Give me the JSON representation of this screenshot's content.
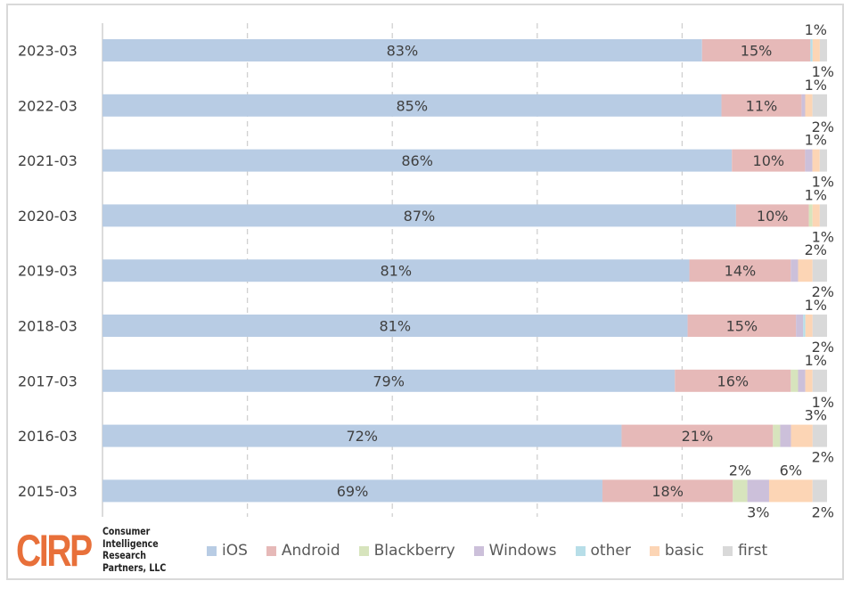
{
  "chart_data": {
    "type": "bar",
    "orientation": "horizontal",
    "stacked": "100%",
    "title": "",
    "xlabel": "",
    "ylabel": "",
    "xlim": [
      0,
      100
    ],
    "grid": true,
    "gridlines_at": [
      20,
      40,
      60,
      80
    ],
    "legend_position": "bottom",
    "categories": [
      "2023-03",
      "2022-03",
      "2021-03",
      "2020-03",
      "2019-03",
      "2018-03",
      "2017-03",
      "2016-03",
      "2015-03"
    ],
    "series": [
      {
        "name": "iOS",
        "color": "#b8cce4",
        "values": [
          83,
          85,
          86,
          87,
          81,
          81,
          79,
          72,
          69
        ]
      },
      {
        "name": "Android",
        "color": "#e6b9b8",
        "values": [
          15,
          11,
          10,
          10,
          14,
          15,
          16,
          21,
          18
        ]
      },
      {
        "name": "Blackberry",
        "color": "#d7e4bd",
        "values": [
          0,
          0,
          0,
          0.5,
          0,
          0,
          1,
          1,
          2
        ]
      },
      {
        "name": "Windows",
        "color": "#ccc0da",
        "values": [
          0,
          0.5,
          1,
          0,
          1,
          1,
          1,
          1.5,
          3
        ]
      },
      {
        "name": "other",
        "color": "#b7dee8",
        "values": [
          0.3,
          0,
          0,
          0,
          0,
          0.3,
          0,
          0,
          0
        ]
      },
      {
        "name": "basic",
        "color": "#fcd5b5",
        "values": [
          1,
          1,
          1,
          1,
          2,
          1,
          1,
          3,
          6
        ]
      },
      {
        "name": "first",
        "color": "#d9d9d9",
        "values": [
          1,
          2,
          1,
          1,
          2,
          2,
          2,
          2,
          2
        ]
      }
    ],
    "data_labels": [
      {
        "category": "2023-03",
        "inside": {
          "iOS": "83%",
          "Android": "15%"
        },
        "above": "1%",
        "below": "1%"
      },
      {
        "category": "2022-03",
        "inside": {
          "iOS": "85%",
          "Android": "11%"
        },
        "above": "1%",
        "below": "2%"
      },
      {
        "category": "2021-03",
        "inside": {
          "iOS": "86%",
          "Android": "10%"
        },
        "above": "1%",
        "below": "1%"
      },
      {
        "category": "2020-03",
        "inside": {
          "iOS": "87%",
          "Android": "10%"
        },
        "above": "1%",
        "below": "1%"
      },
      {
        "category": "2019-03",
        "inside": {
          "iOS": "81%",
          "Android": "14%"
        },
        "above": "2%",
        "below": "2%"
      },
      {
        "category": "2018-03",
        "inside": {
          "iOS": "81%",
          "Android": "15%"
        },
        "above": "1%",
        "below": "2%"
      },
      {
        "category": "2017-03",
        "inside": {
          "iOS": "79%",
          "Android": "16%"
        },
        "above": "1%",
        "below": "1%"
      },
      {
        "category": "2016-03",
        "inside": {
          "iOS": "72%",
          "Android": "21%"
        },
        "above": "3%",
        "below": "2%"
      },
      {
        "category": "2015-03",
        "inside": {
          "iOS": "69%",
          "Android": "18%"
        },
        "above_blackberry": "2%",
        "above_basic": "6%",
        "below_windows": "3%",
        "below_first": "2%"
      }
    ]
  },
  "legend": [
    {
      "name": "iOS",
      "color": "#b8cce4"
    },
    {
      "name": "Android",
      "color": "#e6b9b8"
    },
    {
      "name": "Blackberry",
      "color": "#d7e4bd"
    },
    {
      "name": "Windows",
      "color": "#ccc0da"
    },
    {
      "name": "other",
      "color": "#b7dee8"
    },
    {
      "name": "basic",
      "color": "#fcd5b5"
    },
    {
      "name": "first",
      "color": "#d9d9d9"
    }
  ],
  "logo": {
    "mark": "CIRP",
    "name_lines": [
      "Consumer",
      "Intelligence",
      "Research",
      "Partners, LLC"
    ],
    "color": "#e8703a"
  }
}
